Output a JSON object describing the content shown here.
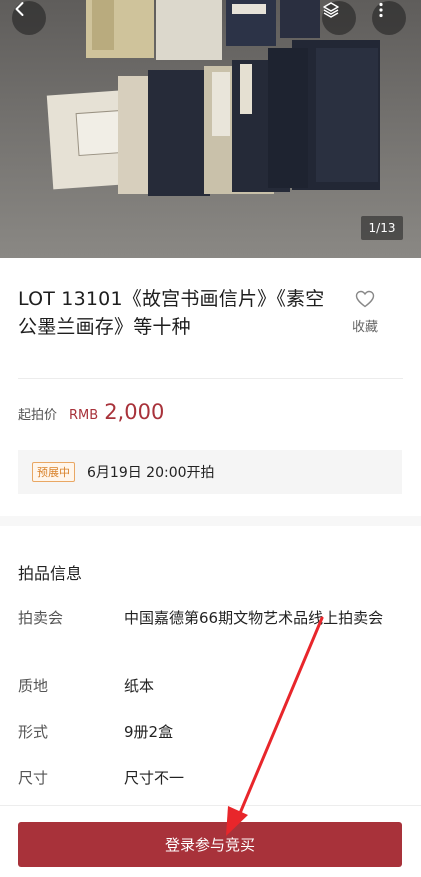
{
  "gallery": {
    "counter": "1/13"
  },
  "lot": {
    "title": "LOT 13101《故宫书画信片》《素空公墨兰画存》等十种",
    "favorite_label": "收藏"
  },
  "price": {
    "label": "起拍价",
    "currency": "RMB",
    "value": "2,000"
  },
  "preview": {
    "badge": "预展中",
    "text": "6月19日 20:00开拍"
  },
  "info": {
    "title": "拍品信息",
    "rows": [
      {
        "label": "拍卖会",
        "value": "中国嘉德第66期文物艺术品线上拍卖会"
      },
      {
        "label": "质地",
        "value": "纸本"
      },
      {
        "label": "形式",
        "value": "9册2盒"
      },
      {
        "label": "尺寸",
        "value": "尺寸不一"
      }
    ]
  },
  "action": {
    "bid_label": "登录参与竞买"
  },
  "colors": {
    "accent": "#a8323a",
    "badge": "#d9822b",
    "annotation": "#e8262b"
  },
  "icons": [
    "back-icon",
    "layers-icon",
    "more-icon",
    "heart-icon"
  ]
}
